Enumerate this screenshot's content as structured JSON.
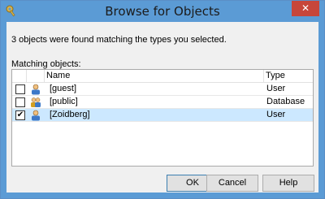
{
  "window": {
    "title": "Browse for Objects",
    "close_label": "✕"
  },
  "dialog": {
    "message": "3 objects were found matching the types you selected.",
    "matching_label": "Matching objects:",
    "columns": {
      "name": "Name",
      "type": "Type"
    },
    "rows": [
      {
        "checked": false,
        "check_glyph": "",
        "name": "[guest]",
        "type": "User",
        "icon": "user-icon",
        "selected": false
      },
      {
        "checked": false,
        "check_glyph": "",
        "name": "[public]",
        "type": "Database role",
        "icon": "role-icon",
        "selected": false
      },
      {
        "checked": true,
        "check_glyph": "✔",
        "name": "[Zoidberg]",
        "type": "User",
        "icon": "user-icon",
        "selected": true
      }
    ],
    "buttons": {
      "ok": "OK",
      "cancel": "Cancel",
      "help": "Help"
    }
  },
  "colors": {
    "titlebar": "#5b9bd5",
    "close": "#c7463a",
    "selected_row": "#cce8ff"
  }
}
